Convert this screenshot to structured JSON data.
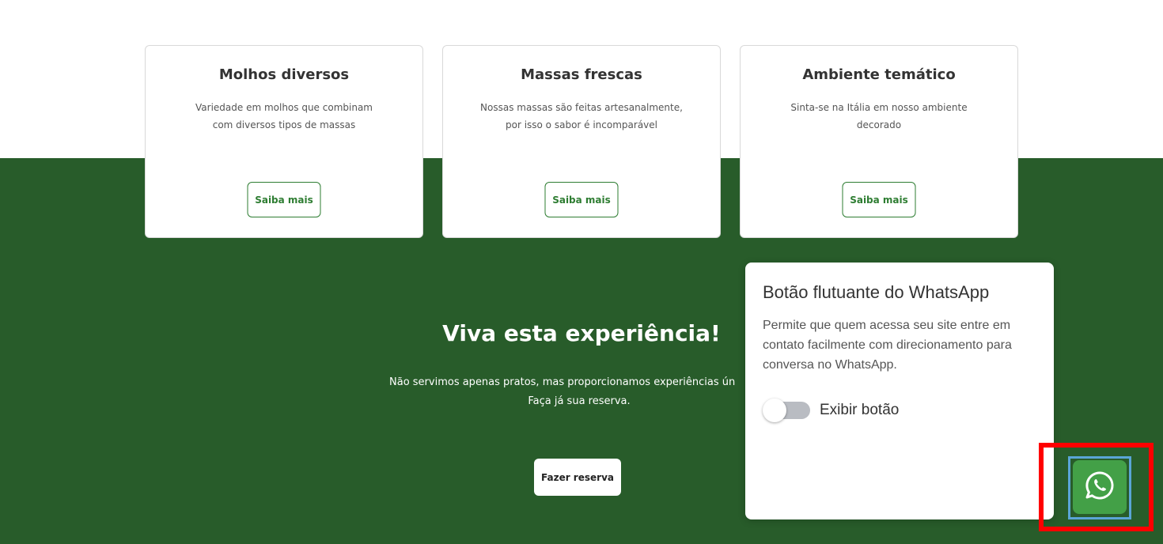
{
  "cards": [
    {
      "title": "Molhos diversos",
      "desc_line1": "Variedade em molhos que combinam",
      "desc_line2": "com diversos tipos de massas",
      "button_label": "Saiba mais"
    },
    {
      "title": "Massas frescas",
      "desc_line1": "Nossas massas são feitas artesanalmente,",
      "desc_line2": "por isso o sabor é incomparável",
      "button_label": "Saiba mais"
    },
    {
      "title": "Ambiente temático",
      "desc_line1": "Sinta-se na Itália em nosso ambiente",
      "desc_line2": "decorado",
      "button_label": "Saiba mais"
    }
  ],
  "experience": {
    "title": "Viva esta experiência!",
    "text_line1": "Não servimos apenas pratos, mas proporcionamos experiências ún",
    "text_line2": "Faça já sua reserva.",
    "button_label": "Fazer reserva"
  },
  "whatsapp_panel": {
    "title": "Botão flutuante do WhatsApp",
    "description": "Permite que quem acessa seu site entre em contato facilmente com direcionamento para conversa no WhatsApp.",
    "toggle_label": "Exibir botão",
    "toggle_on": false
  },
  "floating_button": {
    "icon": "whatsapp-icon"
  },
  "colors": {
    "green_band": "#285c2a",
    "button_green": "#2e7d32",
    "whatsapp_green": "#43a047",
    "highlight_red": "#ff0000",
    "highlight_blue": "#5aa5d6"
  }
}
